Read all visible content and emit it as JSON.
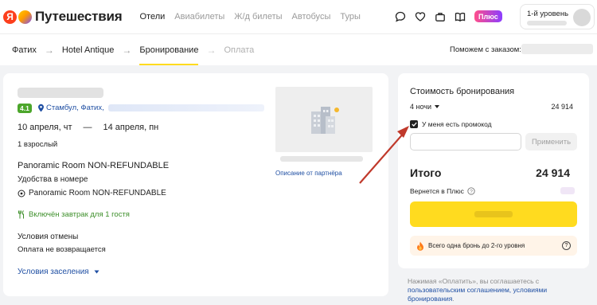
{
  "header": {
    "logo_letter": "Я",
    "app_title": "Путешествия",
    "nav": [
      "Отели",
      "Авиабилеты",
      "Ж/д билеты",
      "Автобусы",
      "Туры"
    ],
    "nav_active": "Отели",
    "plus_label": "Плюс",
    "user_level": "1-й уровень"
  },
  "breadcrumbs": {
    "items": [
      "Фатих",
      "Hotel Antique",
      "Бронирование",
      "Оплата"
    ],
    "current": "Бронирование",
    "help_label": "Поможем с заказом:"
  },
  "hotel": {
    "rating": "4.1",
    "address_prefix": "Стамбул, Фатих,",
    "checkin_date": "10 апреля, чт",
    "dash": "—",
    "checkout_date": "14 апреля, пн",
    "guests": "1 взрослый",
    "room_title": "Panoramic Room NON-REFUNDABLE",
    "amenities_title": "Удобства в номере",
    "amenity": "Panoramic Room NON-REFUNDABLE",
    "breakfast": "Включён завтрак для 1 гостя",
    "cancel_title": "Условия отмены",
    "cancel_text": "Оплата не возвращается",
    "checkin_conditions": "Условия заселения",
    "partner_link": "Описание от партнёра"
  },
  "booking": {
    "title": "Стоимость бронирования",
    "nights": "4 ночи",
    "nights_price": "24 914",
    "promo_label": "У меня есть промокод",
    "promo_placeholder": "",
    "apply_label": "Применить",
    "total_label": "Итого",
    "total_value": "24 914",
    "cashback_label": "Вернется в Плюс",
    "promo_note": "Всего одна бронь до 2-го уровня",
    "terms_prefix": "Нажимая «Оплатить», вы соглашаетесь с",
    "terms_link": "пользовательским соглашением, условиями бронирования",
    "terms_suffix": "."
  },
  "colors": {
    "accent_yellow": "#ffdb1f",
    "link_blue": "#1f4fa3",
    "rating_green": "#4ca62b",
    "annotation_red": "#c0392b"
  }
}
